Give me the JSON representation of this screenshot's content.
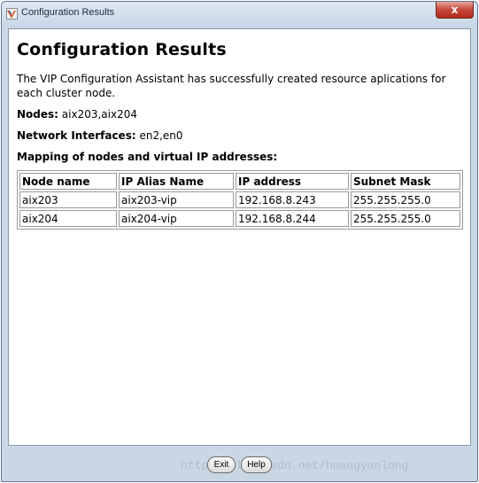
{
  "window": {
    "title": "Configuration Results",
    "close_symbol": "x"
  },
  "content": {
    "heading": "Configuration Results",
    "description": "The VIP Configuration Assistant has successfully created resource aplications for each cluster node.",
    "nodes_label": "Nodes:",
    "nodes_value": "aix203,aix204",
    "interfaces_label": "Network Interfaces:",
    "interfaces_value": "en2,en0",
    "mapping_label": "Mapping of nodes and virtual IP addresses:"
  },
  "table": {
    "headers": [
      "Node name",
      "IP Alias Name",
      "IP address",
      "Subnet Mask"
    ],
    "rows": [
      [
        "aix203",
        "aix203-vip",
        "192.168.8.243",
        "255.255.255.0"
      ],
      [
        "aix204",
        "aix204-vip",
        "192.168.8.244",
        "255.255.255.0"
      ]
    ]
  },
  "footer": {
    "exit_label": "Exit",
    "help_label": "Help",
    "watermark": "http://blog.csdn.net/huangyanlong"
  }
}
